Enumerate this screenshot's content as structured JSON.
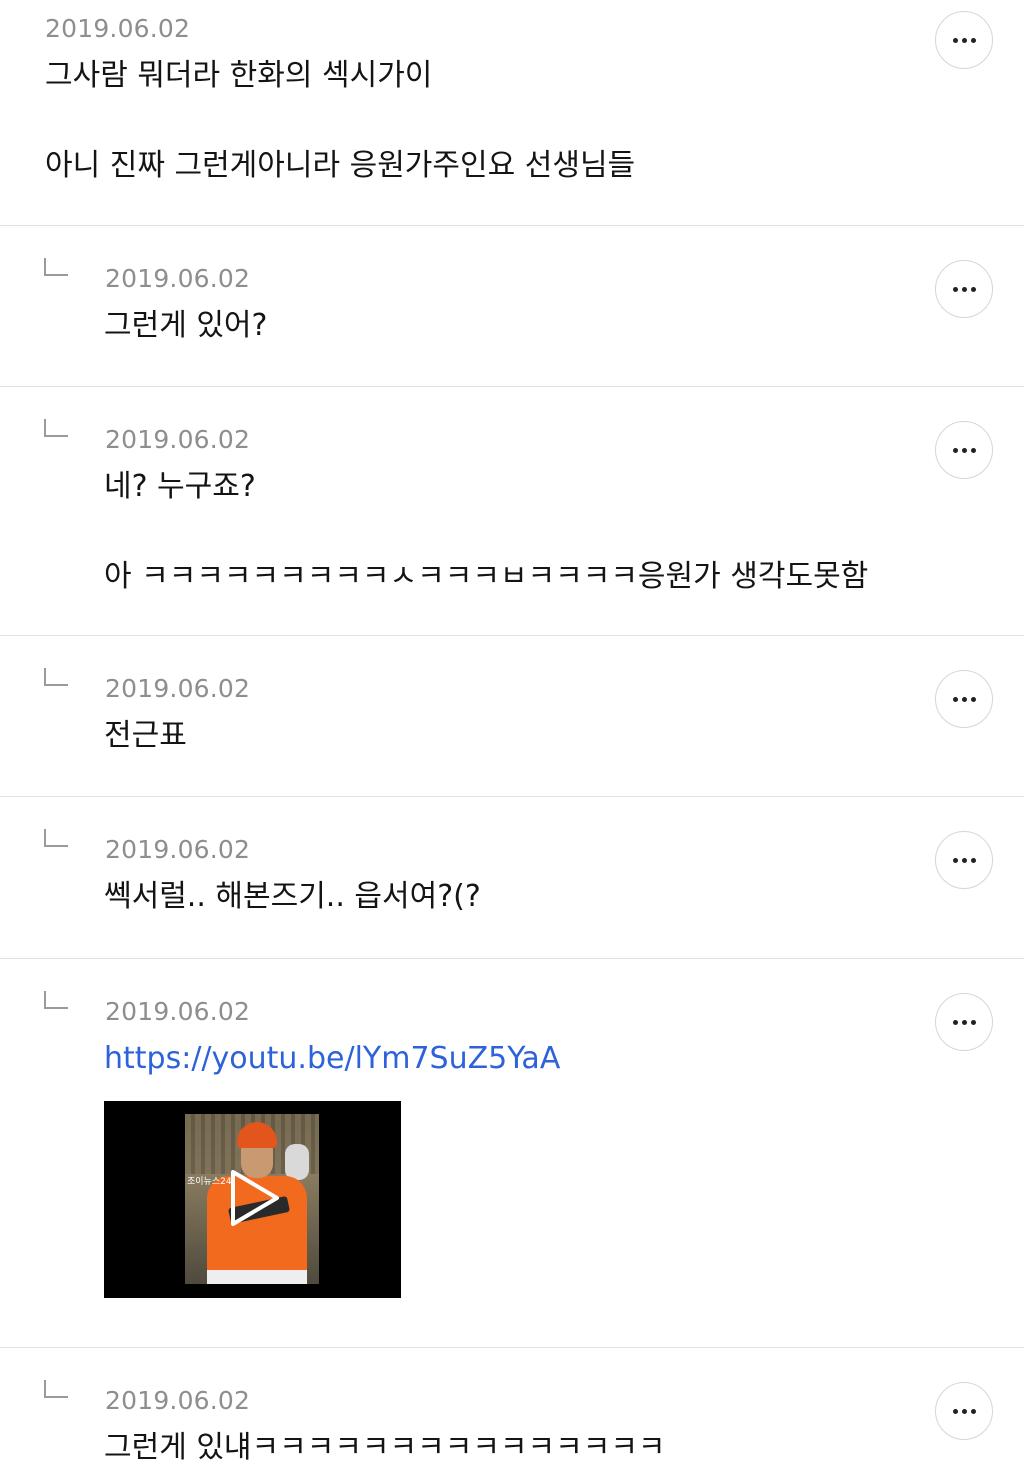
{
  "comments": [
    {
      "date": "2019.06.02",
      "line1": "그사람 뭐더라 한화의 섹시가이",
      "line2": "아니 진짜 그런게아니라 응원가주인요 선생님들"
    },
    {
      "date": "2019.06.02",
      "line1": "그런게 있어?"
    },
    {
      "date": "2019.06.02",
      "line1": "네? 누구죠?",
      "line2": "아 ㅋㅋㅋㅋㅋㅋㅋㅋㅋㅅㅋㅋㅋㅂㅋㅋㅋㅋ응원가 생각도못함"
    },
    {
      "date": "2019.06.02",
      "line1": "전근표"
    },
    {
      "date": "2019.06.02",
      "line1": "쎅서럴.. 해본즈기.. 읍서여?(?"
    },
    {
      "date": "2019.06.02",
      "link": "https://youtu.be/lYm7SuZ5YaA",
      "video_caption": "조이뉴스24"
    },
    {
      "date": "2019.06.02",
      "line1": "그런게 있냬ㅋㅋㅋㅋㅋㅋㅋㅋㅋㅋㅋㅋㅋㅋㅋ"
    }
  ],
  "icons": {
    "reply": "reply-arrow-icon",
    "more": "more-options-icon",
    "play": "play-icon"
  },
  "colors": {
    "link": "#2d62d9",
    "date": "#8e8e8e",
    "divider": "#e2e2e2"
  }
}
